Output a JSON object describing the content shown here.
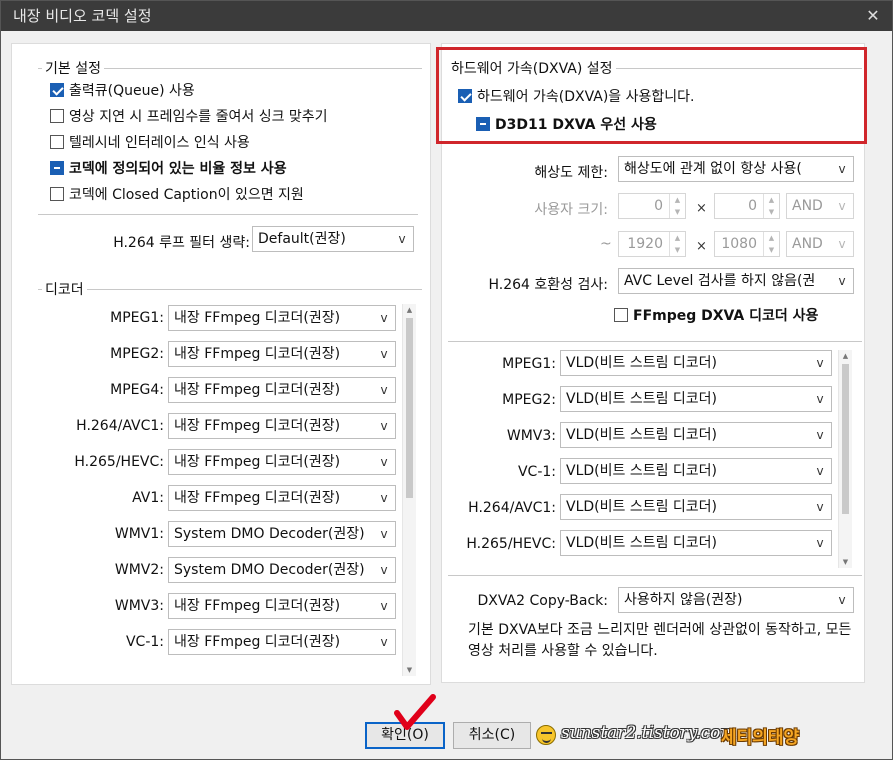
{
  "window": {
    "title": "내장 비디오 코덱 설정",
    "close_glyph": "✕"
  },
  "basic": {
    "title": "기본 설정",
    "options": [
      {
        "label": "출력큐(Queue) 사용",
        "state": "checked"
      },
      {
        "label": "영상 지연 시 프레임수를 줄여서 싱크 맞추기",
        "state": "unchecked"
      },
      {
        "label": "텔레시네 인터레이스 인식 사용",
        "state": "unchecked"
      },
      {
        "label": "코덱에 정의되어 있는 비율 정보 사용",
        "state": "indeterminate"
      },
      {
        "label": "코덱에 Closed Caption이 있으면 지원",
        "state": "unchecked"
      }
    ],
    "loopfilter_label": "H.264 루프 필터 생략:",
    "loopfilter_value": "Default(권장)"
  },
  "decoder": {
    "title": "디코더",
    "rows": [
      {
        "label": "MPEG1:",
        "value": "내장 FFmpeg 디코더(권장)"
      },
      {
        "label": "MPEG2:",
        "value": "내장 FFmpeg 디코더(권장)"
      },
      {
        "label": "MPEG4:",
        "value": "내장 FFmpeg 디코더(권장)"
      },
      {
        "label": "H.264/AVC1:",
        "value": "내장 FFmpeg 디코더(권장)"
      },
      {
        "label": "H.265/HEVC:",
        "value": "내장 FFmpeg 디코더(권장)"
      },
      {
        "label": "AV1:",
        "value": "내장 FFmpeg 디코더(권장)"
      },
      {
        "label": "WMV1:",
        "value": "System DMO Decoder(권장)"
      },
      {
        "label": "WMV2:",
        "value": "System DMO Decoder(권장)"
      },
      {
        "label": "WMV3:",
        "value": "내장 FFmpeg 디코더(권장)"
      },
      {
        "label": "VC-1:",
        "value": "내장 FFmpeg 디코더(권장)"
      }
    ]
  },
  "hw": {
    "title": "하드웨어 가속(DXVA) 설정",
    "enable_label": "하드웨어 가속(DXVA)을 사용합니다.",
    "d3d11_label": "D3D11 DXVA 우선 사용",
    "resolution_label": "해상도 제한:",
    "resolution_value": "해상도에 관계 없이 항상 사용(",
    "custom_size_label": "사용자 크기:",
    "custom_w": "0",
    "custom_h": "0",
    "custom_op": "AND",
    "tilde": "~",
    "max_w": "1920",
    "max_h": "1080",
    "max_op": "AND",
    "times": "×",
    "compat_label": "H.264 호환성 검사:",
    "compat_value": "AVC Level 검사를 하지 않음(권",
    "ffmpeg_dxva_label": "FFmpeg DXVA 디코더 사용",
    "rows": [
      {
        "label": "MPEG1:",
        "value": "VLD(비트 스트림 디코더)"
      },
      {
        "label": "MPEG2:",
        "value": "VLD(비트 스트림 디코더)"
      },
      {
        "label": "WMV3:",
        "value": "VLD(비트 스트림 디코더)"
      },
      {
        "label": "VC-1:",
        "value": "VLD(비트 스트림 디코더)"
      },
      {
        "label": "H.264/AVC1:",
        "value": "VLD(비트 스트림 디코더)"
      },
      {
        "label": "H.265/HEVC:",
        "value": "VLD(비트 스트림 디코더)"
      }
    ],
    "copyback_label": "DXVA2 Copy-Back:",
    "copyback_value": "사용하지 않음(권장)",
    "description": "기본 DXVA보다 조금 느리지만 렌더러에 상관없이 동작하고, 모든 영상 처리를 사용할 수 있습니다."
  },
  "buttons": {
    "ok": "확인(O)",
    "cancel": "취소(C)"
  },
  "watermark": {
    "url": "sunstar2.tistory.com",
    "brand": "세티의태양"
  },
  "icons": {
    "dropdown": "v",
    "up": "▲",
    "down": "▼"
  },
  "colors": {
    "accent": "#1a5fb4",
    "highlight": "#d0262b",
    "check_mark": "#e0001a"
  }
}
